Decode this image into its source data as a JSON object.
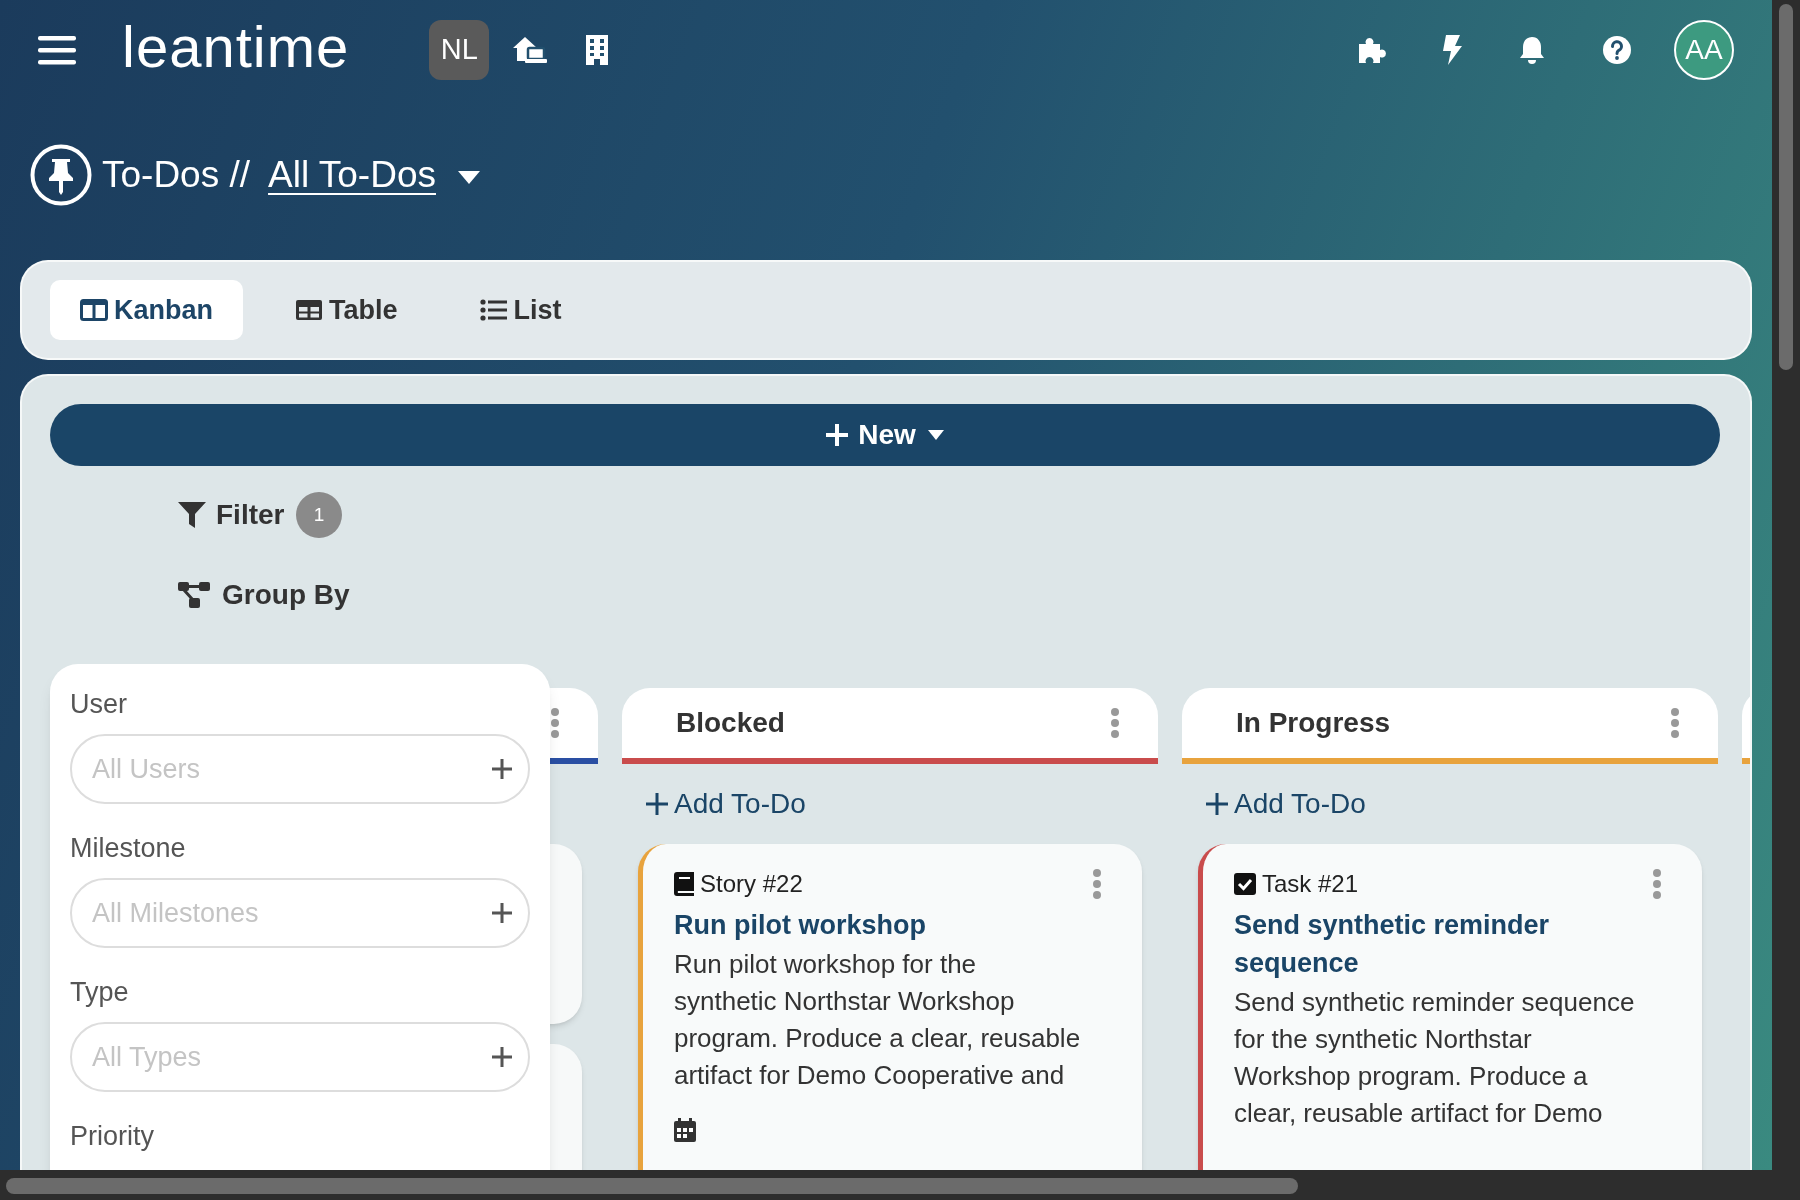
{
  "topbar": {
    "logo": "leantime",
    "project_badge": "NL",
    "avatar": "AA"
  },
  "breadcrumb": {
    "section": "To-Dos //",
    "current": "All To-Dos"
  },
  "view_tabs": [
    {
      "label": "Kanban",
      "kind": "kanban",
      "selected": true
    },
    {
      "label": "Table",
      "kind": "table",
      "selected": false
    },
    {
      "label": "List",
      "kind": "list",
      "selected": false
    }
  ],
  "new_button": "New",
  "filter": {
    "label": "Filter",
    "count": "1"
  },
  "group_by": "Group By",
  "filter_panel": {
    "fields": [
      {
        "label": "User",
        "placeholder": "All Users"
      },
      {
        "label": "Milestone",
        "placeholder": "All Milestones"
      },
      {
        "label": "Type",
        "placeholder": "All Types"
      }
    ],
    "last_label": "Priority"
  },
  "columns": [
    {
      "color": "#2a4fa3",
      "menu": true,
      "cards": [
        {
          "kind": "covered"
        },
        {
          "kind": "covered"
        }
      ]
    },
    {
      "title": "Blocked",
      "color": "#c94c4c",
      "menu": true,
      "add_label": "Add To-Do",
      "cards": [
        {
          "kind": "story",
          "ref": "Story #22",
          "title": "Run pilot workshop",
          "description_lines": [
            "Run pilot workshop for the",
            "synthetic Northstar Workshop",
            "program. Produce a clear, reusable",
            "artifact for Demo Cooperative and"
          ],
          "color": "#e8a33d",
          "has_date": true
        }
      ]
    },
    {
      "title": "In Progress",
      "color": "#e8a33d",
      "menu": true,
      "add_label": "Add To-Do",
      "cards": [
        {
          "kind": "task",
          "ref": "Task #21",
          "title": "Send synthetic reminder sequence",
          "description_lines": [
            "Send synthetic reminder sequence",
            "for the synthetic Northstar",
            "Workshop program. Produce a",
            "clear, reusable artifact for Demo"
          ],
          "color": "#c94c4c",
          "has_date": false
        }
      ]
    },
    {
      "color": "#e8a33d"
    }
  ]
}
